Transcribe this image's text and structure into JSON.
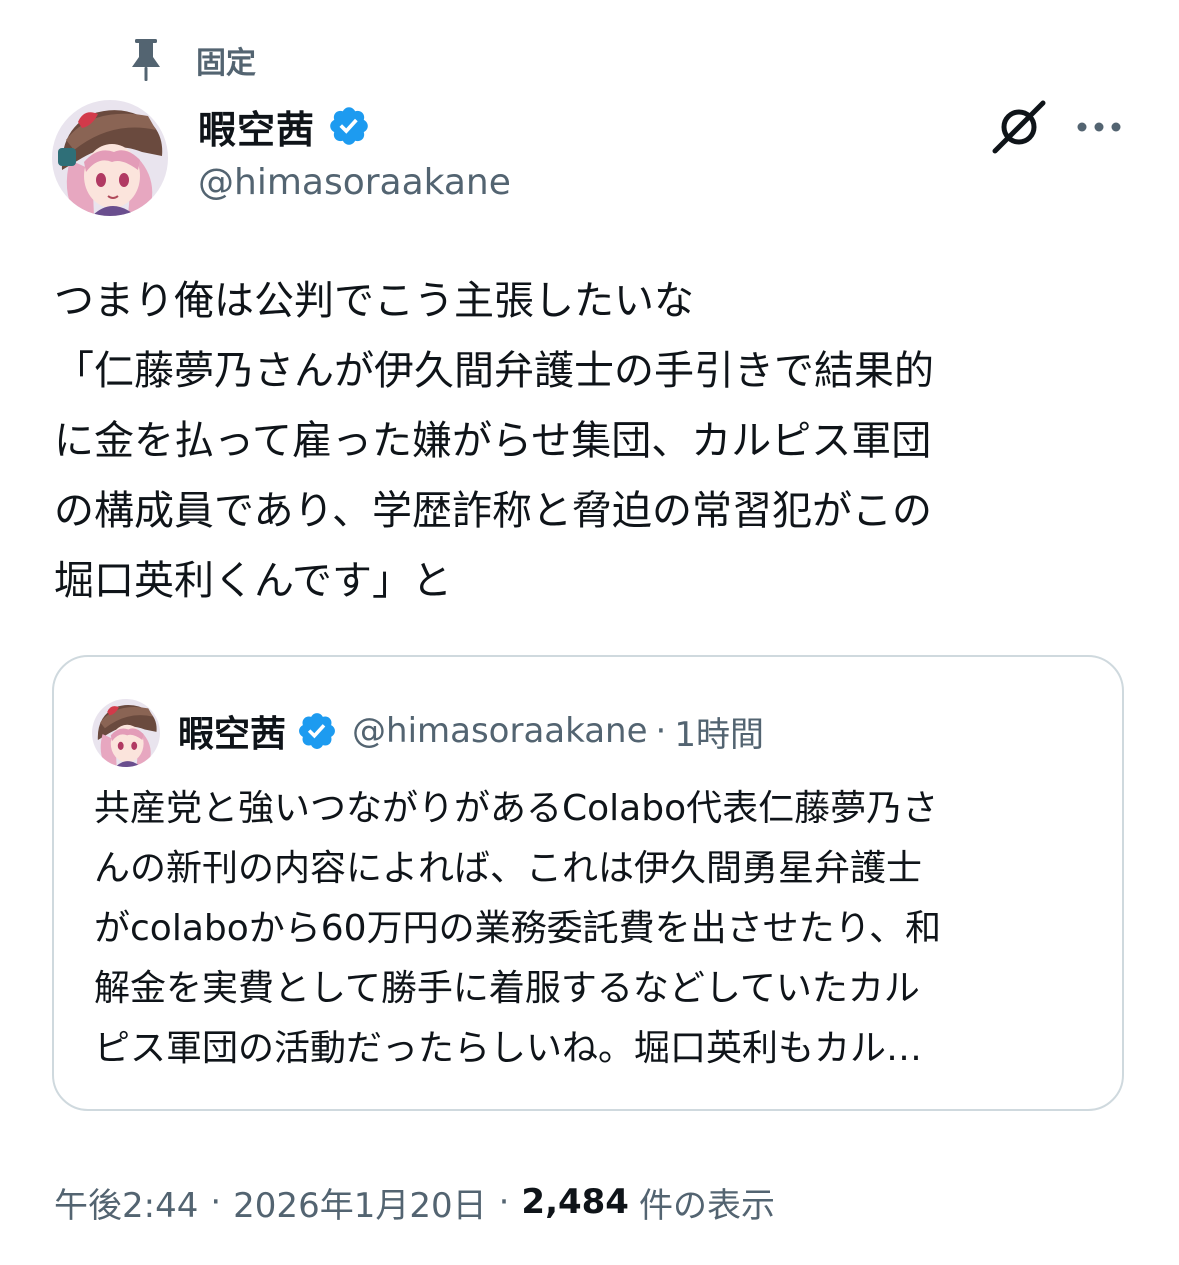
{
  "pinned": {
    "icon": "pin-icon",
    "label": "固定"
  },
  "author": {
    "display_name": "暇空茜",
    "verified": true,
    "handle": "@himasoraakane"
  },
  "actions": {
    "grok_icon": "grok-icon",
    "more_icon": "more-icon"
  },
  "tweet": {
    "text": "つまり俺は公判でこう主張したいな\n「仁藤夢乃さんが伊久間弁護士の手引きで結果的\nに金を払って雇った嫌がらせ集団、カルピス軍団\nの構成員であり、学歴詐称と脅迫の常習犯がこの\n堀口英利くんです」と"
  },
  "quoted_tweet": {
    "display_name": "暇空茜",
    "verified": true,
    "handle": "@himasoraakane",
    "separator": "·",
    "time": "1時間",
    "text": "共産党と強いつながりがあるColabo代表仁藤夢乃さ\nんの新刊の内容によれば、これは伊久間勇星弁護士\nがcolaboから60万円の業務委託費を出させたり、和\n解金を実費として勝手に着服するなどしていたカル\nピス軍団の活動だったらしいね。堀口英利もカル…"
  },
  "meta": {
    "time": "午後2:44",
    "separator": "·",
    "date": "2026年1月20日",
    "views_count": "2,484",
    "views_label": "件の表示"
  },
  "colors": {
    "text_primary": "#0f1419",
    "text_secondary": "#536471",
    "verified_blue": "#1d9bf0",
    "border": "#cfd9de"
  }
}
